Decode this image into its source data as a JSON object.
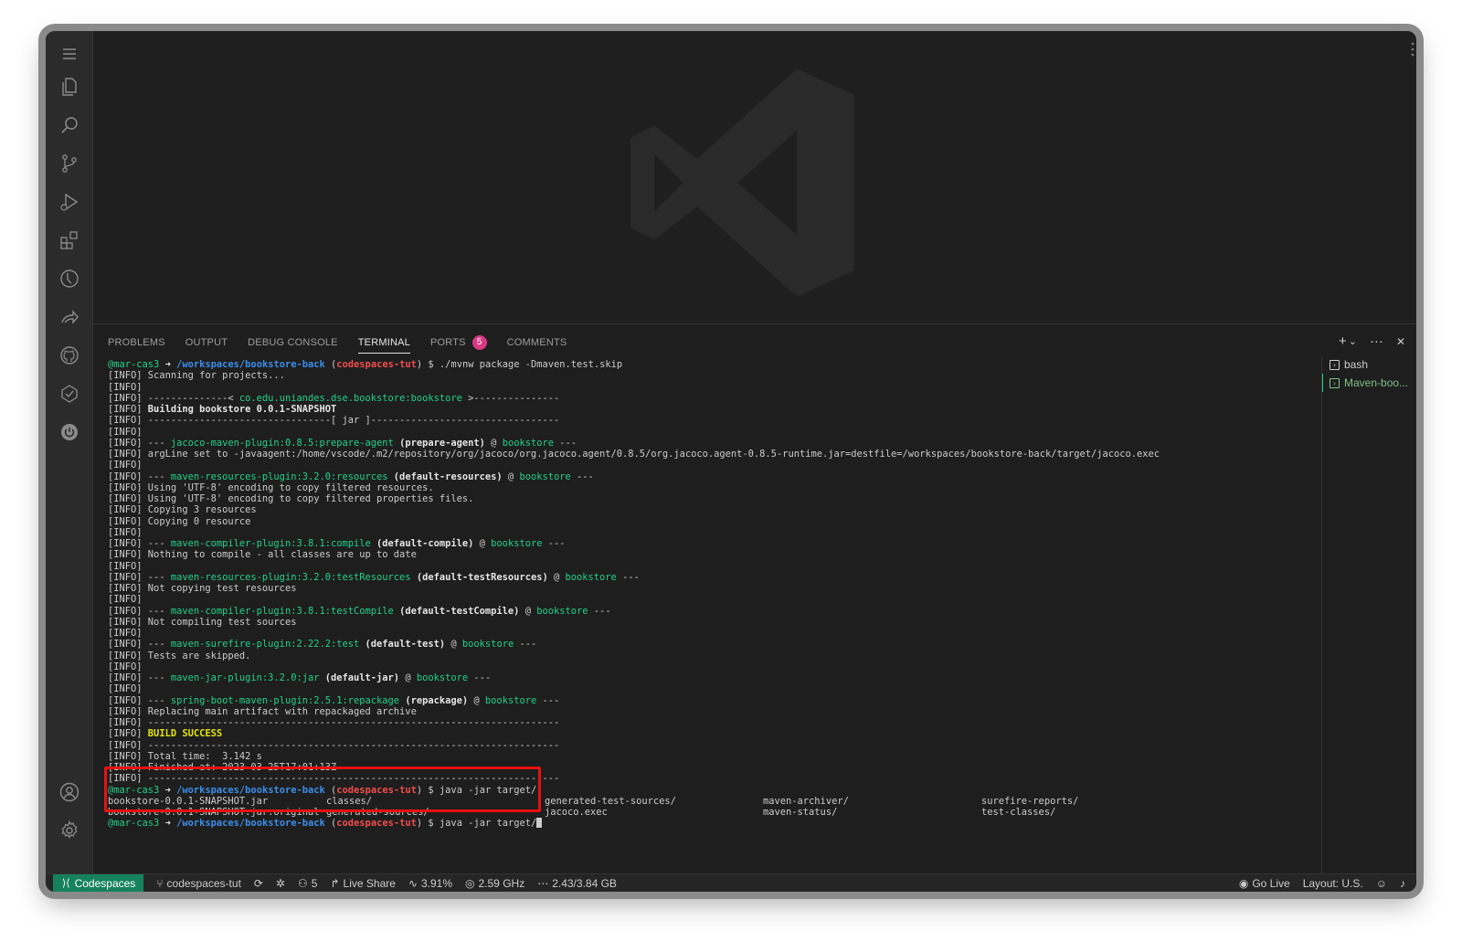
{
  "panel": {
    "tabs": [
      {
        "label": "PROBLEMS"
      },
      {
        "label": "OUTPUT"
      },
      {
        "label": "DEBUG CONSOLE"
      },
      {
        "label": "TERMINAL",
        "active": true
      },
      {
        "label": "PORTS",
        "badge": "5"
      },
      {
        "label": "COMMENTS"
      }
    ],
    "actions": {
      "new": "+",
      "dropdown": "⌄",
      "more": "···",
      "close": "✕"
    }
  },
  "terminal": {
    "prompt": {
      "user": "@mar-cas3",
      "arrow": "➜",
      "path": "/workspaces/bookstore-back",
      "branch": "codespaces-tut",
      "dollar": "$"
    },
    "command1": "./mvnw package -Dmaven.test.skip",
    "log": [
      {
        "tag": "[INFO]",
        "text": " Scanning for projects..."
      },
      {
        "tag": "[INFO]",
        "text": ""
      },
      {
        "tag": "[INFO]",
        "pre": " --------------< ",
        "green": "co.edu.uniandes.dse.bookstore:bookstore",
        "post": " >---------------"
      },
      {
        "tag": "[INFO]",
        "bold": " Building bookstore 0.0.1-SNAPSHOT"
      },
      {
        "tag": "[INFO]",
        "text": " --------------------------------[ jar ]---------------------------------"
      },
      {
        "tag": "[INFO]",
        "text": ""
      },
      {
        "tag": "[INFO]",
        "pre": " --- ",
        "green": "jacoco-maven-plugin:0.8.5:prepare-agent",
        "bold2": " (prepare-agent)",
        "mid": " @ ",
        "green2": "bookstore",
        "post": " ---"
      },
      {
        "tag": "[INFO]",
        "text": " argLine set to -javaagent:/home/vscode/.m2/repository/org/jacoco/org.jacoco.agent/0.8.5/org.jacoco.agent-0.8.5-runtime.jar=destfile=/workspaces/bookstore-back/target/jacoco.exec"
      },
      {
        "tag": "[INFO]",
        "text": ""
      },
      {
        "tag": "[INFO]",
        "pre": " --- ",
        "green": "maven-resources-plugin:3.2.0:resources",
        "bold2": " (default-resources)",
        "mid": " @ ",
        "green2": "bookstore",
        "post": " ---"
      },
      {
        "tag": "[INFO]",
        "text": " Using 'UTF-8' encoding to copy filtered resources."
      },
      {
        "tag": "[INFO]",
        "text": " Using 'UTF-8' encoding to copy filtered properties files."
      },
      {
        "tag": "[INFO]",
        "text": " Copying 3 resources"
      },
      {
        "tag": "[INFO]",
        "text": " Copying 0 resource"
      },
      {
        "tag": "[INFO]",
        "text": ""
      },
      {
        "tag": "[INFO]",
        "pre": " --- ",
        "green": "maven-compiler-plugin:3.8.1:compile",
        "bold2": " (default-compile)",
        "mid": " @ ",
        "green2": "bookstore",
        "post": " ---"
      },
      {
        "tag": "[INFO]",
        "text": " Nothing to compile - all classes are up to date"
      },
      {
        "tag": "[INFO]",
        "text": ""
      },
      {
        "tag": "[INFO]",
        "pre": " --- ",
        "green": "maven-resources-plugin:3.2.0:testResources",
        "bold2": " (default-testResources)",
        "mid": " @ ",
        "green2": "bookstore",
        "post": " ---"
      },
      {
        "tag": "[INFO]",
        "text": " Not copying test resources"
      },
      {
        "tag": "[INFO]",
        "text": ""
      },
      {
        "tag": "[INFO]",
        "pre": " --- ",
        "green": "maven-compiler-plugin:3.8.1:testCompile",
        "bold2": " (default-testCompile)",
        "mid": " @ ",
        "green2": "bookstore",
        "post": " ---"
      },
      {
        "tag": "[INFO]",
        "text": " Not compiling test sources"
      },
      {
        "tag": "[INFO]",
        "text": ""
      },
      {
        "tag": "[INFO]",
        "pre": " --- ",
        "green": "maven-surefire-plugin:2.22.2:test",
        "bold2": " (default-test)",
        "mid": " @ ",
        "green2": "bookstore",
        "post": " ---"
      },
      {
        "tag": "[INFO]",
        "text": " Tests are skipped."
      },
      {
        "tag": "[INFO]",
        "text": ""
      },
      {
        "tag": "[INFO]",
        "pre": " --- ",
        "green": "maven-jar-plugin:3.2.0:jar",
        "bold2": " (default-jar)",
        "mid": " @ ",
        "green2": "bookstore",
        "post": " ---"
      },
      {
        "tag": "[INFO]",
        "text": ""
      },
      {
        "tag": "[INFO]",
        "pre": " --- ",
        "green": "spring-boot-maven-plugin:2.5.1:repackage",
        "bold2": " (repackage)",
        "mid": " @ ",
        "green2": "bookstore",
        "post": " ---"
      },
      {
        "tag": "[INFO]",
        "text": " Replacing main artifact with repackaged archive"
      },
      {
        "tag": "[INFO]",
        "text": " ------------------------------------------------------------------------"
      },
      {
        "tag": "[INFO]",
        "yellow": " BUILD SUCCESS"
      },
      {
        "tag": "[INFO]",
        "text": " ------------------------------------------------------------------------"
      },
      {
        "tag": "[INFO]",
        "text": " Total time:  3.142 s"
      },
      {
        "tag": "[INFO]",
        "text": " Finished at: 2023-03-25T17:01:13Z"
      },
      {
        "tag": "[INFO]",
        "text": " ------------------------------------------------------------------------"
      }
    ],
    "command2": "java -jar target/",
    "completions": [
      [
        "bookstore-0.0.1-SNAPSHOT.jar",
        "classes/",
        "generated-test-sources/",
        "maven-archiver/",
        "surefire-reports/"
      ],
      [
        "bookstore-0.0.1-SNAPSHOT.jar.original",
        "generated-sources/",
        "jacoco.exec",
        "maven-status/",
        "test-classes/"
      ]
    ],
    "command3": "java -jar target/"
  },
  "terminal_list": [
    {
      "label": "bash"
    },
    {
      "label": "Maven-boo...",
      "active": true
    }
  ],
  "status_bar": {
    "remote": "Codespaces",
    "branch": "codespaces-tut",
    "ports": "5",
    "live_share": "Live Share",
    "cpu": "3.91%",
    "freq": "2.59 GHz",
    "mem": "2.43/3.84 GB",
    "go_live": "Go Live",
    "layout": "Layout: U.S."
  },
  "colors": {
    "accent_remote": "#16825d",
    "badge": "#d73a82",
    "highlight": "#e81010",
    "prompt_green": "#23d18b",
    "prompt_path": "#3b8eea",
    "prompt_branch": "#f14c4c"
  },
  "icons": [
    "menu-icon",
    "explorer-icon",
    "search-icon",
    "source-control-icon",
    "run-debug-icon",
    "extensions-icon",
    "timeline-icon",
    "live-share-icon",
    "github-icon",
    "testing-icon",
    "power-icon",
    "account-icon",
    "settings-gear-icon"
  ]
}
